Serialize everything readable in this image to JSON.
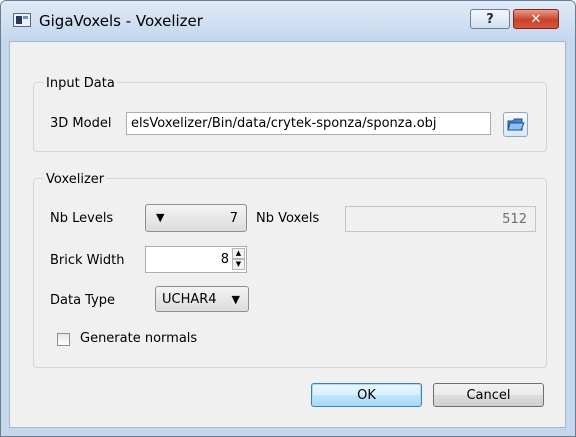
{
  "window": {
    "title": "GigaVoxels - Voxelizer"
  },
  "titlebar": {
    "help_label": "?",
    "close_label": "✕"
  },
  "input_data": {
    "group_title": "Input Data",
    "model_label": "3D Model",
    "model_path": "elsVoxelizer/Bin/data/crytek-sponza/sponza.obj"
  },
  "voxelizer": {
    "group_title": "Voxelizer",
    "nb_levels_label": "Nb Levels",
    "nb_levels_value": "7",
    "nb_voxels_label": "Nb Voxels",
    "nb_voxels_value": "512",
    "brick_width_label": "Brick Width",
    "brick_width_value": "8",
    "data_type_label": "Data Type",
    "data_type_value": "UCHAR4",
    "generate_normals_label": "Generate normals",
    "generate_normals_checked": false
  },
  "buttons": {
    "ok": "OK",
    "cancel": "Cancel"
  }
}
